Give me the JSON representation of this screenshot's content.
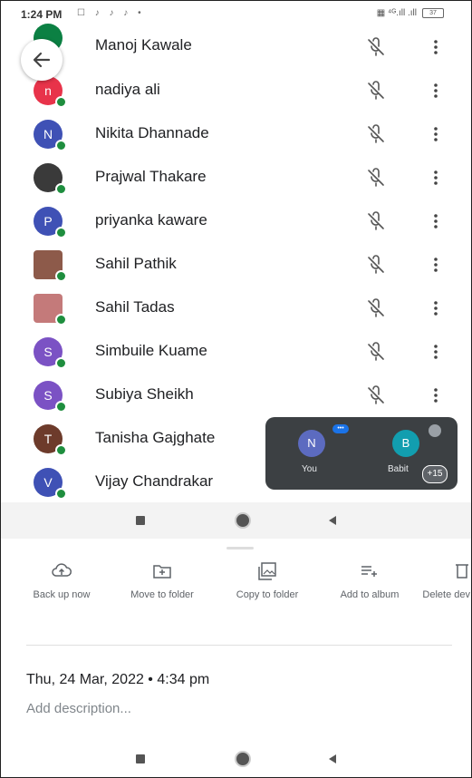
{
  "status_bar": {
    "time": "1:24 PM",
    "notification_icons": "☐ ♪ ♪ ♪ •",
    "network": "▦ ⁴ᴳ.ıll .ıll",
    "battery": "37"
  },
  "participants": [
    {
      "name": "Manoj Kawale",
      "initial": "",
      "color": "#0b8043"
    },
    {
      "name": "nadiya ali",
      "initial": "n",
      "color": "#e8334a"
    },
    {
      "name": "Nikita Dhannade",
      "initial": "N",
      "color": "#3f51b5"
    },
    {
      "name": "Prajwal Thakare",
      "initial": "",
      "color": "#3a3a3a"
    },
    {
      "name": "priyanka kaware",
      "initial": "P",
      "color": "#3f51b5"
    },
    {
      "name": "Sahil Pathik",
      "initial": "",
      "color": "#8d5a4a"
    },
    {
      "name": "Sahil Tadas",
      "initial": "",
      "color": "#c47a7a"
    },
    {
      "name": "Simbuile Kuame",
      "initial": "S",
      "color": "#7b52c4"
    },
    {
      "name": "Subiya Sheikh",
      "initial": "S",
      "color": "#7b52c4"
    },
    {
      "name": "Tanisha Gajghate",
      "initial": "T",
      "color": "#6d3b2b"
    },
    {
      "name": "Vijay Chandrakar",
      "initial": "V",
      "color": "#3f51b5"
    }
  ],
  "self_view": {
    "you": {
      "initial": "N",
      "label": "You",
      "color": "#5c6bc0"
    },
    "other": {
      "initial": "B",
      "label": "Babit",
      "color": "#129eaf"
    },
    "more_count": "+15"
  },
  "actions": [
    {
      "label": "Back up now"
    },
    {
      "label": "Move to folder"
    },
    {
      "label": "Copy to folder"
    },
    {
      "label": "Add to album"
    },
    {
      "label": "Delete dev"
    }
  ],
  "photo_info": {
    "date": "Thu, 24 Mar, 2022 • 4:34 pm",
    "description_placeholder": "Add description..."
  }
}
